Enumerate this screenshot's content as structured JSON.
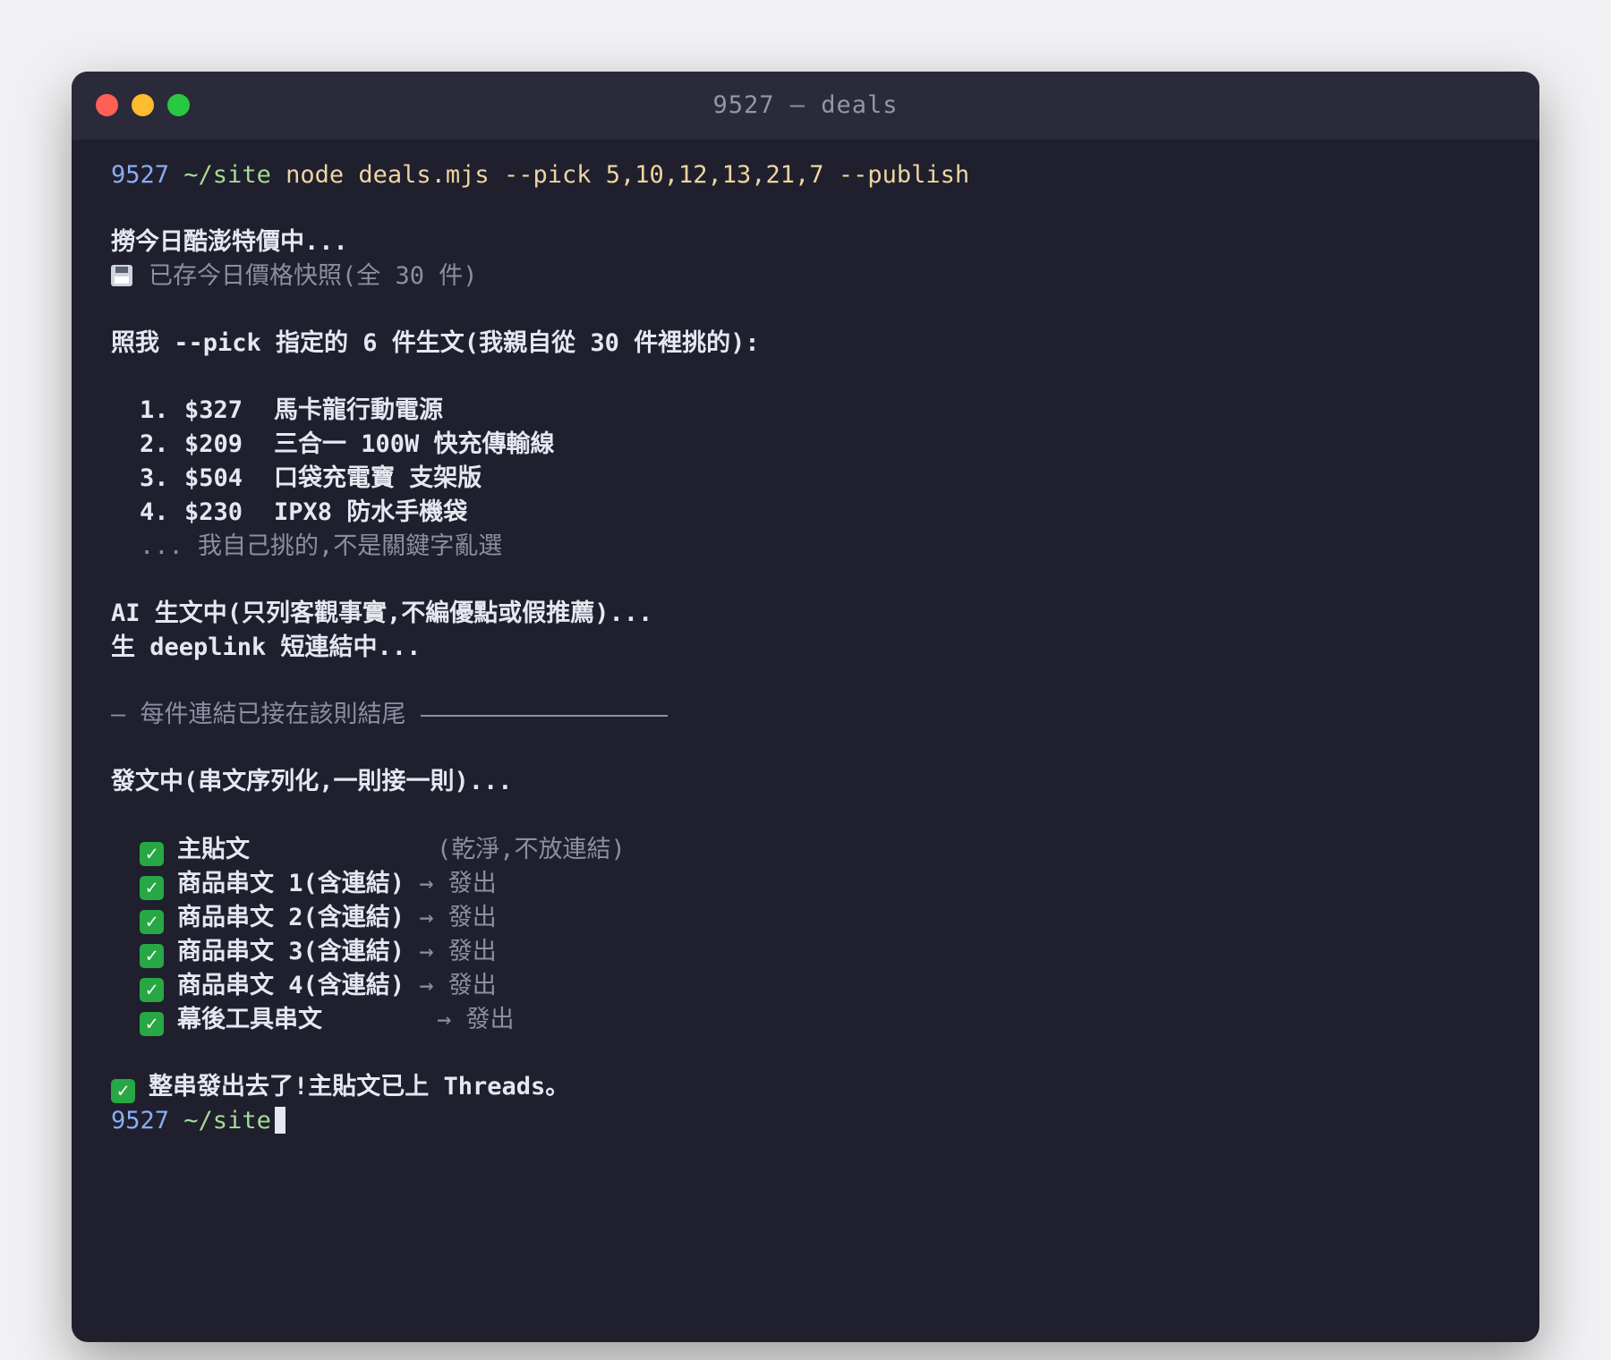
{
  "window": {
    "title": "9527 — deals"
  },
  "prompt": {
    "host": "9527",
    "path": "~/site",
    "command": "node deals.mjs --pick 5,10,12,13,21,7 --publish"
  },
  "output": {
    "fetching": "撈今日酷澎特價中...",
    "snapshot": "已存今日價格快照(全 30 件)",
    "pick_intro": "照我 --pick 指定的 6 件生文(我親自從 30 件裡挑的):",
    "items": [
      {
        "num": "1.",
        "price": "$327",
        "name": "馬卡龍行動電源"
      },
      {
        "num": "2.",
        "price": "$209",
        "name": "三合一 100W 快充傳輸線"
      },
      {
        "num": "3.",
        "price": "$504",
        "name": "口袋充電寶 支架版"
      },
      {
        "num": "4.",
        "price": "$230",
        "name": "IPX8 防水手機袋"
      }
    ],
    "items_more": "... 我自己挑的,不是關鍵字亂選",
    "ai_gen": "AI 生文中(只列客觀事實,不編優點或假推薦)...",
    "deeplink": "生 deeplink 短連結中...",
    "divider": "— 每件連結已接在該則結尾",
    "posting": "發文中(串文序列化,一則接一則)...",
    "status": [
      {
        "label": "主貼文",
        "note": "(乾淨,不放連結)"
      },
      {
        "label": "商品串文 1(含連結)",
        "note": "→ 發出"
      },
      {
        "label": "商品串文 2(含連結)",
        "note": "→ 發出"
      },
      {
        "label": "商品串文 3(含連結)",
        "note": "→ 發出"
      },
      {
        "label": "商品串文 4(含連結)",
        "note": "→ 發出"
      },
      {
        "label": "幕後工具串文",
        "note": "→ 發出"
      }
    ],
    "done": "整串發出去了!主貼文已上 Threads。"
  },
  "final_prompt": {
    "host": "9527",
    "path": "~/site"
  },
  "colors": {
    "bg": "#1f1f2e",
    "titlebar": "#2a2a3b",
    "prompt": "#8aadf4",
    "path": "#a6da95",
    "command": "#eed49f",
    "check": "#28a745"
  }
}
